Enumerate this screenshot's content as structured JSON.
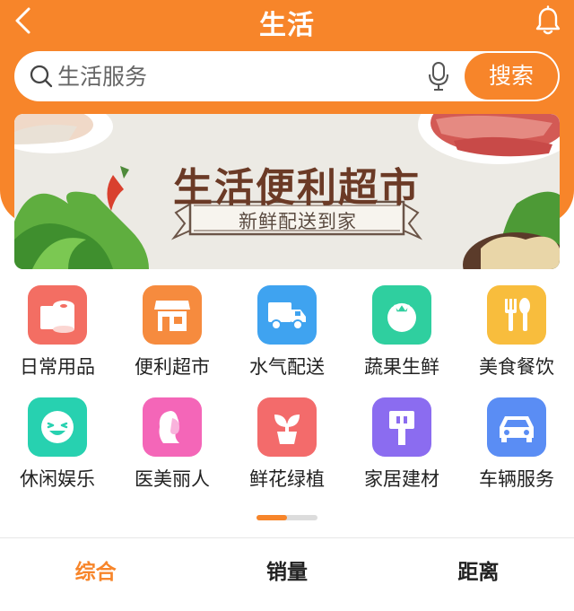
{
  "app": {
    "title": "生活",
    "accent": "#f7852a"
  },
  "search": {
    "placeholder": "生活服务",
    "button_label": "搜索"
  },
  "banner": {
    "title": "生活便利超市",
    "subtitle": "新鲜配送到家"
  },
  "categories": [
    {
      "label": "日常用品",
      "icon": "tissue-roll-icon",
      "color": "#f36e63"
    },
    {
      "label": "便利超市",
      "icon": "store-icon",
      "color": "#f68b3e"
    },
    {
      "label": "水气配送",
      "icon": "truck-icon",
      "color": "#3fa3f0"
    },
    {
      "label": "蔬果生鲜",
      "icon": "tomato-icon",
      "color": "#2fcf9f"
    },
    {
      "label": "美食餐饮",
      "icon": "fork-spoon-icon",
      "color": "#f8bd3d"
    },
    {
      "label": "休闲娱乐",
      "icon": "smile-icon",
      "color": "#27d1b0"
    },
    {
      "label": "医美丽人",
      "icon": "woman-icon",
      "color": "#f466b8"
    },
    {
      "label": "鲜花绿植",
      "icon": "plant-icon",
      "color": "#f36b6b"
    },
    {
      "label": "家居建材",
      "icon": "plug-icon",
      "color": "#8b6cf0"
    },
    {
      "label": "车辆服务",
      "icon": "car-icon",
      "color": "#5a8df4"
    }
  ],
  "pager": {
    "current_page": 1,
    "total_pages": 2
  },
  "sort_tabs": [
    {
      "label": "综合",
      "active": true
    },
    {
      "label": "销量",
      "active": false
    },
    {
      "label": "距离",
      "active": false
    }
  ]
}
